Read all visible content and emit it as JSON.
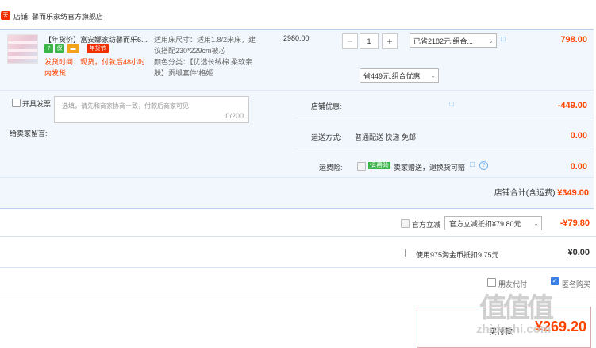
{
  "shop": {
    "tag": "天猫",
    "label": "店铺: 馨而乐家纺官方旗舰店"
  },
  "product": {
    "title": "【年货价】富安娜家纺馨而乐6...",
    "badges": [
      {
        "icon": "seven-day-return-icon",
        "text": "7",
        "color": "#3bb547"
      },
      {
        "icon": "shield-icon",
        "text": "保",
        "color": "#3bb547"
      },
      {
        "icon": "card-icon",
        "text": "▬",
        "color": "#f3a41a"
      },
      {
        "icon": "new-year-tag",
        "text": "年货节",
        "color": "#f22e00"
      }
    ],
    "ship_info": "发货时间：现货，付款后48小时内发货",
    "sku_lines": [
      "适用床尺寸：适用1.8/2米床，建",
      "议搭配230*229cm被芯",
      "颜色分类：【优选长绒棉 柔软亲",
      "肤】贡缎套件\\格姬"
    ],
    "unit_price": "2980.00",
    "qty": "1",
    "qty_minus": "−",
    "qty_plus": "+",
    "promo": "已省2182元:组合...",
    "subtotal": "798.00"
  },
  "invoice_label": "开具发票",
  "remark": {
    "label": "给卖家留言:",
    "placeholder": "选填，请先和商家协商一致，付款后商家可见",
    "count": "0/200"
  },
  "coupon": {
    "label": "店铺优惠:",
    "value": "省449元:组合优惠",
    "amount": "-449.00"
  },
  "shipping": {
    "label": "运送方式:",
    "value": "普通配送 快递 免邮",
    "amount": "0.00"
  },
  "insurance": {
    "label": "运费险:",
    "tag": "运费险",
    "desc": "卖家赠送，退换货可赔",
    "help": "?",
    "amount": "0.00"
  },
  "shop_total": {
    "label": "店铺合计(含运费)",
    "value": "¥349.00"
  },
  "gov_subsidy": {
    "label": "官方立减",
    "select": "官方立减抵扣¥79.80元",
    "amount": "-¥79.80"
  },
  "taojinbi": {
    "label": "使用975淘金币抵扣9.75元",
    "amount": "¥0.00"
  },
  "options": {
    "anonymous": "匿名购买",
    "pay_for": "朋友代付"
  },
  "final": {
    "label": "实付款:",
    "value": "¥269.20"
  },
  "watermark": {
    "logo": "值",
    "site": "zhidezhi.com"
  }
}
